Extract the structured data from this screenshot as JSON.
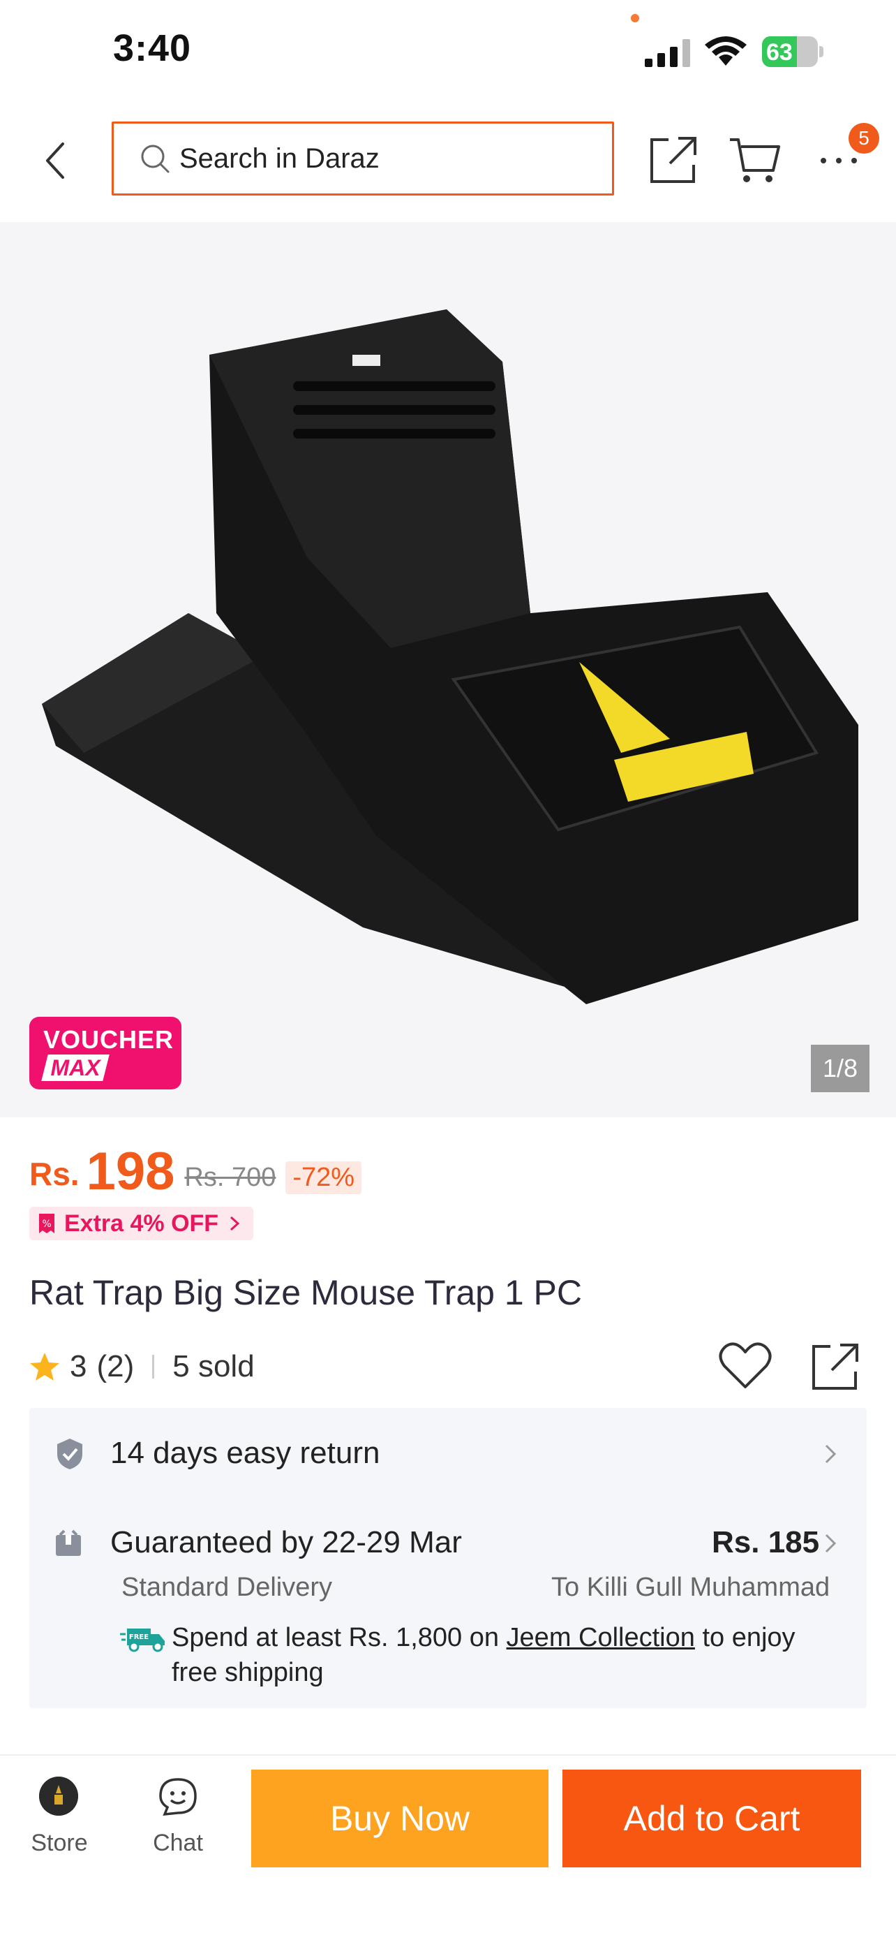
{
  "status_bar": {
    "time": "3:40",
    "battery": "63",
    "battery_level": 0.63,
    "icons": [
      "signal-icon",
      "wifi-icon",
      "battery-icon"
    ]
  },
  "header": {
    "search_placeholder": "Search in Daraz",
    "more_badge": "5",
    "icons": [
      "back-icon",
      "search-icon",
      "share-icon",
      "cart-icon",
      "more-icon"
    ]
  },
  "gallery": {
    "voucher_top": "VOUCHER",
    "voucher_bottom": "MAX",
    "counter": "1/8"
  },
  "price": {
    "currency": "Rs.",
    "value": "198",
    "original": "Rs. 700",
    "discount": "-72%",
    "extra": "Extra 4% OFF"
  },
  "product": {
    "title": "Rat Trap Big Size Mouse Trap 1 PC",
    "rating": "3",
    "reviews": "(2)",
    "sold": "5 sold"
  },
  "info": {
    "return": "14 days easy return",
    "guarantee": "Guaranteed by 22-29 Mar",
    "shipping_price": "Rs. 185",
    "delivery_type": "Standard Delivery",
    "delivery_to": "To Killi Gull Muhammad",
    "spend_prefix": "Spend at least Rs. 1,800 on ",
    "spend_store": "Jeem Collection",
    "spend_suffix": "  to enjoy free shipping",
    "free_badge": "FREE"
  },
  "bottom_bar": {
    "store": "Store",
    "chat": "Chat",
    "buy_now": "Buy Now",
    "add_to_cart": "Add to Cart"
  },
  "colors": {
    "accent": "#f05a1a",
    "buy_now": "#fda31f",
    "add_to_cart": "#f75710",
    "voucher": "#f0116e"
  }
}
